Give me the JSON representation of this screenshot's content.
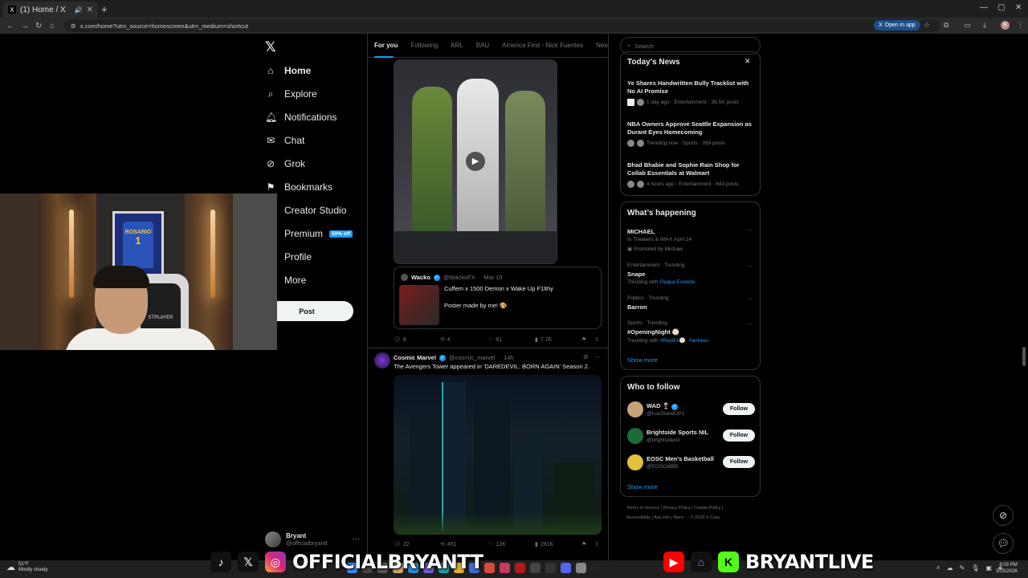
{
  "browser": {
    "tab_title": "(1) Home / X",
    "url": "x.com/home?utm_source=homescreen&utm_medium=shortcut",
    "open_in_app": "Open in app",
    "profile_initial": "B"
  },
  "nav": {
    "items": [
      {
        "label": "Home",
        "icon": "home-icon"
      },
      {
        "label": "Explore",
        "icon": "search-icon"
      },
      {
        "label": "Notifications",
        "icon": "bell-icon"
      },
      {
        "label": "Chat",
        "icon": "mail-icon"
      },
      {
        "label": "Grok",
        "icon": "grok-icon"
      },
      {
        "label": "Bookmarks",
        "icon": "bookmark-icon"
      },
      {
        "label": "Creator Studio",
        "icon": "creator-icon"
      },
      {
        "label": "Premium",
        "icon": "premium-icon",
        "badge": "50% off"
      },
      {
        "label": "Profile",
        "icon": "profile-icon"
      },
      {
        "label": "More",
        "icon": "more-icon"
      }
    ],
    "post_label": "Post",
    "account": {
      "name": "Bryant",
      "handle": "@officialbryantt"
    }
  },
  "feed": {
    "tabs": [
      "For you",
      "Following",
      "ARL",
      "BAU",
      "America First - Nick Fuentes",
      "Nexdoor"
    ],
    "quote": {
      "name": "Wacko",
      "handle": "@WackoFX",
      "date": "Mar 15",
      "text": "Cuffem x 1500 Demon x Wake Up F1lthy",
      "subtext": "Poster made by me! 🎨"
    },
    "tweet1_actions": {
      "replies": "8",
      "reposts": "4",
      "likes": "61",
      "views": "7.7K"
    },
    "tweet2": {
      "name": "Cosmic Marvel",
      "handle": "@cosmic_marvel",
      "time": "14h",
      "text": "The Avengers Tower appeared in 'DAREDEVIL: BORN AGAIN' Season 2."
    },
    "tweet2_actions": {
      "replies": "22",
      "reposts": "451",
      "likes": "12K",
      "views": "281K"
    }
  },
  "right": {
    "search_placeholder": "Search",
    "todays_news": {
      "title": "Today's News",
      "items": [
        {
          "headline": "Ye Shares Handwritten Bully Tracklist with No AI Promise",
          "meta": "1 day ago · Entertainment · 39.5K posts"
        },
        {
          "headline": "NBA Owners Approve Seattle Expansion as Durant Eyes Homecoming",
          "meta": "Trending now · Sports · 269 posts"
        },
        {
          "headline": "Bhad Bhabie and Sophie Rain Shop for Collab Essentials at Walmart",
          "meta": "4 hours ago · Entertainment · 643 posts"
        }
      ]
    },
    "whats_happening": {
      "title": "What’s happening",
      "promo": {
        "name": "MICHAEL",
        "line": "In Theaters & IMAX April 24",
        "promoted": "Promoted by Michael"
      },
      "trends": [
        {
          "category": "Entertainment · Trending",
          "name": "Snape",
          "sub_prefix": "Trending with",
          "sub_link": "Paapa Essiedu"
        },
        {
          "category": "Politics · Trending",
          "name": "Barron",
          "sub_prefix": "",
          "sub_link": ""
        },
        {
          "category": "Sports · Trending",
          "name": "#OpeningNight ⚾",
          "sub_prefix": "Trending with",
          "sub_link": "#RepBX⚾, Yankees"
        }
      ],
      "show_more": "Show more"
    },
    "who_to_follow": {
      "title": "Who to follow",
      "accounts": [
        {
          "name": "WAD 🍷",
          "handle": "@LouStandUP1"
        },
        {
          "name": "Brightside Sports NIL",
          "handle": "@brightsidenil"
        },
        {
          "name": "EOSC Men's Basketball",
          "handle": "@EOSCMBB"
        }
      ],
      "follow_label": "Follow",
      "show_more": "Show more"
    },
    "footer_line1": "Terms of Service  |  Privacy Policy  |  Cookie Policy  |",
    "footer_line2": "Accessibility  |  Ads info  |  More ···  © 2026 X Corp."
  },
  "overlay": {
    "left_handle": "OFFICIALBRYANTT",
    "right_handle": "BRYANTLIVE",
    "jersey_text": "ROSARIO",
    "jersey_number": "1",
    "chair_text": "STPLAYER"
  },
  "taskbar": {
    "temp": "51°F",
    "weather": "Mostly cloudy",
    "time": "8:03 PM",
    "date": "3/25/2026"
  },
  "colors": {
    "accent": "#1d9bf0",
    "background": "#000000",
    "border": "#2f3336"
  }
}
